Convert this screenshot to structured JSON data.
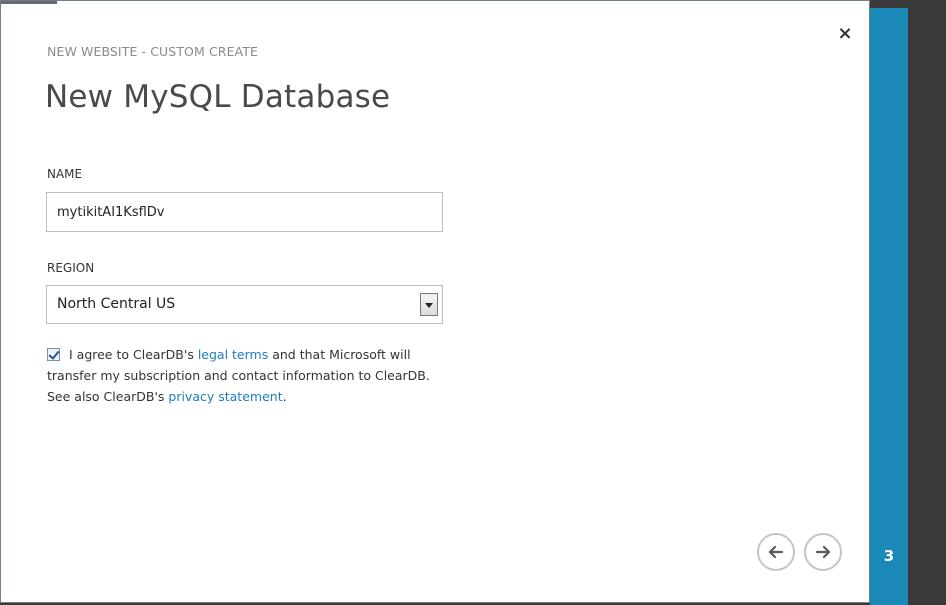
{
  "wizard": {
    "subtitle": "NEW WEBSITE - CUSTOM CREATE",
    "title": "New MySQL Database",
    "close_label": "×",
    "step": "3"
  },
  "form": {
    "name_label": "NAME",
    "name_value": "mytikitAI1KsflDv",
    "region_label": "REGION",
    "region_value": "North Central US"
  },
  "agreement": {
    "checked": true,
    "text_1": "I agree to ClearDB's",
    "link_1": "legal terms",
    "text_2": "and that Microsoft will transfer my subscription and contact information to ClearDB. See also ClearDB's",
    "link_2": "privacy statement",
    "text_3": "."
  },
  "navigation": {
    "back_icon": "arrow-left-icon",
    "next_icon": "arrow-right-icon"
  },
  "colors": {
    "accent": "#1b89b8",
    "link": "#1f7eb8",
    "background": "#3a3a3a"
  }
}
